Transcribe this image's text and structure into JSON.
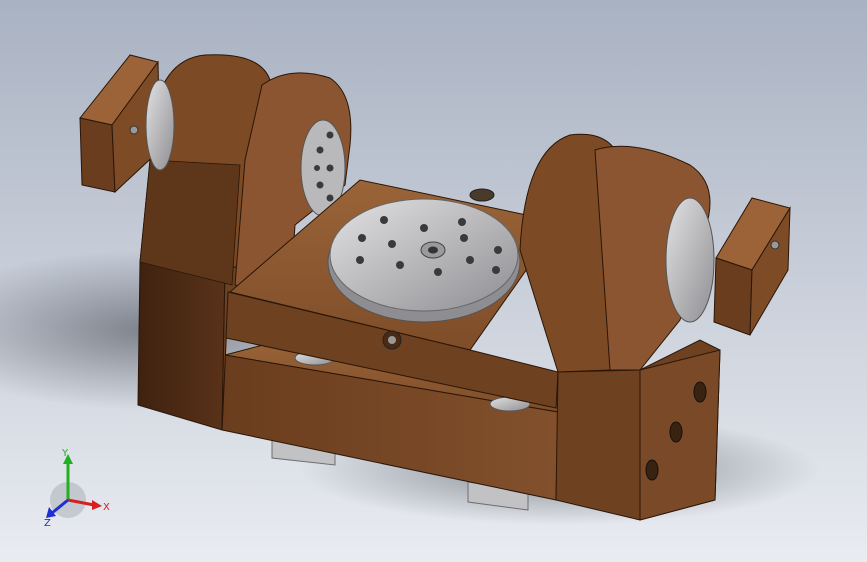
{
  "viewport": {
    "background_top": "#a9b2c2",
    "background_bottom": "#e9ecf1"
  },
  "model": {
    "body_color": "#7a4a28",
    "body_shadow": "#4e2c14",
    "metal_color": "#b5b5b8"
  },
  "triad": {
    "x_label": "X",
    "y_label": "Y",
    "z_label": "Z",
    "x_color": "#d42020",
    "y_color": "#20b020",
    "z_color": "#2030d0"
  }
}
